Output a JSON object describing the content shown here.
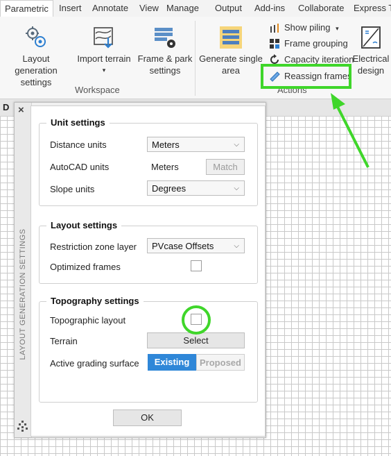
{
  "ribbon": {
    "tabs": [
      "Parametric",
      "Insert",
      "Annotate",
      "View",
      "Manage",
      "Output",
      "Add-ins",
      "Collaborate",
      "Express To"
    ],
    "active_tab": "Parametric",
    "workspace": {
      "layout_gen_line1": "Layout generation",
      "layout_gen_line2": "settings",
      "import_terrain": "Import terrain",
      "import_terrain_arrow": "▾",
      "frame_park_line1": "Frame & park",
      "frame_park_line2": "settings",
      "group_label": "Workspace"
    },
    "actions": {
      "generate_line1": "Generate single",
      "generate_line2": "area",
      "show_piling": "Show piling",
      "show_piling_arrow": "▾",
      "frame_grouping": "Frame grouping",
      "capacity_iteration": "Capacity iteration",
      "reassign_frames": "Reassign frames",
      "electrical_line1": "Electrical",
      "electrical_line2": "design",
      "group_label": "Actions"
    }
  },
  "doc_tab_label": "D",
  "palette": {
    "close": "×",
    "title": "LAYOUT GENERATION SETTINGS",
    "unit_settings": {
      "title": "Unit settings",
      "distance_label": "Distance units",
      "distance_value": "Meters",
      "autocad_label": "AutoCAD units",
      "autocad_value": "Meters",
      "match_button": "Match",
      "slope_label": "Slope units",
      "slope_value": "Degrees"
    },
    "layout_settings": {
      "title": "Layout settings",
      "restriction_label": "Restriction zone layer",
      "restriction_value": "PVcase Offsets",
      "optimized_label": "Optimized frames"
    },
    "topography_settings": {
      "title": "Topography settings",
      "topographic_label": "Topographic layout",
      "terrain_label": "Terrain",
      "terrain_button": "Select",
      "grading_label": "Active grading surface",
      "grading_on": "Existing",
      "grading_off": "Proposed"
    },
    "ok_button": "OK"
  },
  "colors": {
    "highlight": "#3fd62a",
    "accent": "#2f87d8"
  }
}
